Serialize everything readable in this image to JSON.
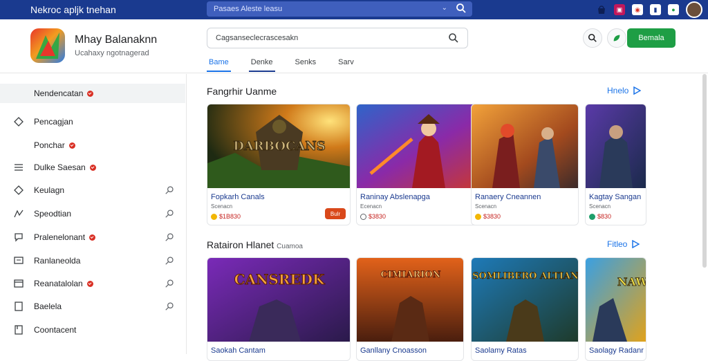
{
  "topbar": {
    "brand": "Nekroc apljk tnehan",
    "search_text": "Pasaes Aleste leasu",
    "icons": [
      "shop-icon",
      "gift-icon",
      "pin-icon",
      "phone-icon",
      "notifications-icon"
    ]
  },
  "app": {
    "title": "Mhay Balanaknn",
    "subtitle": "Ucahaxy ngotnagerad",
    "search_value": "Cagsanseclecrascesakn",
    "tabs": [
      "Bame",
      "Denke",
      "Senks",
      "Sarv"
    ],
    "cta_label": "Bemala",
    "accent": "#1a73e8",
    "cta_color": "#1e9e45",
    "header_bar_color": "#1a3a8f"
  },
  "sidebar": {
    "items": [
      {
        "label": "Nendencatan",
        "icon": "",
        "badge": true,
        "pin": false,
        "selected": true
      },
      {
        "label": "Pencagjan",
        "icon": "diamond-icon",
        "badge": false,
        "pin": false,
        "selected": false
      },
      {
        "label": "Ponchar",
        "icon": "",
        "badge": true,
        "pin": false,
        "selected": false
      },
      {
        "label": "Dulke Saesan",
        "icon": "menu-icon",
        "badge": true,
        "pin": false,
        "selected": false
      },
      {
        "label": "Keulagn",
        "icon": "diamond-icon",
        "badge": false,
        "pin": true,
        "selected": false
      },
      {
        "label": "Speodtian",
        "icon": "graph-icon",
        "badge": false,
        "pin": true,
        "selected": false
      },
      {
        "label": "Pralenelonant",
        "icon": "chat-icon",
        "badge": true,
        "pin": true,
        "selected": false
      },
      {
        "label": "Ranlaneolda",
        "icon": "monitor-icon",
        "badge": false,
        "pin": true,
        "selected": false
      },
      {
        "label": "Reanatalolan",
        "icon": "window-icon",
        "badge": true,
        "pin": true,
        "selected": false
      },
      {
        "label": "Baelela",
        "icon": "doc-icon",
        "badge": false,
        "pin": true,
        "selected": false
      },
      {
        "label": "Coontacent",
        "icon": "contact-icon",
        "badge": false,
        "pin": false,
        "selected": false
      }
    ]
  },
  "sections": [
    {
      "title": "Fangrhir Uanme",
      "subtitle": "",
      "more": "Hnelo",
      "cards": [
        {
          "art_title": "DARBOCANS",
          "title": "Fopkarh Canals",
          "sub": "Scenacn",
          "price": "$1B830",
          "coin": "#f2b705",
          "button": "Bulr"
        },
        {
          "art_title": "",
          "title": "Raninay Abslenapga",
          "sub": "Ecenacn",
          "price": "$3830",
          "coin": "#5f6368",
          "button": ""
        },
        {
          "art_title": "",
          "title": "Ranaery Cneannen",
          "sub": "Scenacn",
          "price": "$3830",
          "coin": "#f2b705",
          "button": ""
        },
        {
          "art_title": "",
          "title": "Kagtay Sangan",
          "sub": "Scenacn",
          "price": "$830",
          "coin": "#1e9e6a",
          "button": ""
        }
      ]
    },
    {
      "title": "Ratairon Hlanet",
      "subtitle": "Cuamoa",
      "more": "Fitleo",
      "cards": [
        {
          "art_title": "CANSREDK",
          "title": "Saokah Cantam",
          "sub": "",
          "price": "",
          "coin": "",
          "button": ""
        },
        {
          "art_title": "CIMIARION",
          "title": "Ganllany Cnoasson",
          "sub": "",
          "price": "",
          "coin": "",
          "button": ""
        },
        {
          "art_title": "SOMLIBERO ALTIAN",
          "title": "Saolamy Ratas",
          "sub": "",
          "price": "",
          "coin": "",
          "button": ""
        },
        {
          "art_title": "NAW",
          "title": "Saolagy Radanr",
          "sub": "",
          "price": "",
          "coin": "",
          "button": ""
        }
      ]
    }
  ]
}
